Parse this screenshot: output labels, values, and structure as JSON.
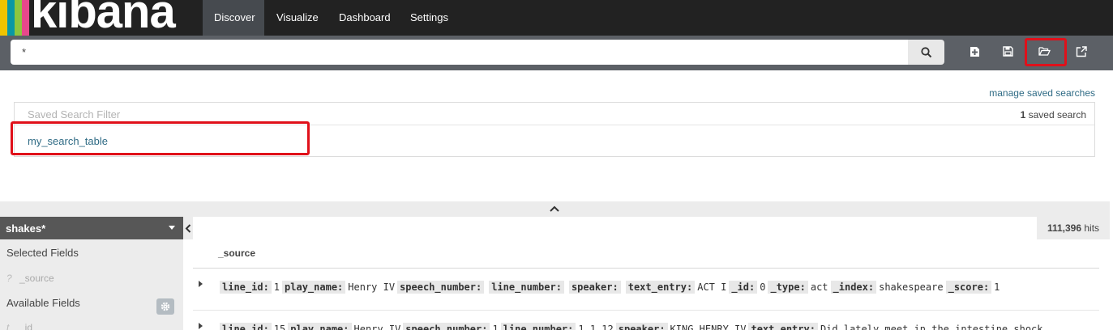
{
  "app": {
    "logo_text": "kibana",
    "logo_colors": [
      "#f1c400",
      "#0a98a4",
      "#8dc63f",
      "#e8488b"
    ]
  },
  "nav": {
    "tabs": [
      {
        "label": "Discover",
        "active": true
      },
      {
        "label": "Visualize",
        "active": false
      },
      {
        "label": "Dashboard",
        "active": false
      },
      {
        "label": "Settings",
        "active": false
      }
    ]
  },
  "search": {
    "query": "*",
    "icon": "search-icon"
  },
  "toolbar": {
    "icons": [
      "new-search-icon",
      "save-icon",
      "open-folder-icon",
      "share-icon"
    ],
    "highlighted": "open-folder-icon",
    "highlight_color": "#e0101a"
  },
  "saved_searches": {
    "manage_link": "manage saved searches",
    "filter_placeholder": "Saved Search Filter",
    "count": "1",
    "count_label": "saved search",
    "items": [
      "my_search_table"
    ]
  },
  "sidebar": {
    "index_pattern": "shakes*",
    "selected_heading": "Selected Fields",
    "selected_fields": [
      {
        "type": "?",
        "name": "_source"
      }
    ],
    "available_heading": "Available Fields",
    "available_fields": [
      {
        "type": "t",
        "name": "_id"
      }
    ]
  },
  "results": {
    "hits": "111,396",
    "hits_label": "hits",
    "column": "_source",
    "rows": [
      {
        "fields": [
          {
            "key": "line_id:",
            "value": "1"
          },
          {
            "key": "play_name:",
            "value": "Henry IV"
          },
          {
            "key": "speech_number:",
            "value": ""
          },
          {
            "key": "line_number:",
            "value": ""
          },
          {
            "key": "speaker:",
            "value": ""
          },
          {
            "key": "text_entry:",
            "value": "ACT I"
          },
          {
            "key": "_id:",
            "value": "0"
          },
          {
            "key": "_type:",
            "value": "act"
          },
          {
            "key": "_index:",
            "value": "shakespeare"
          },
          {
            "key": "_score:",
            "value": "1"
          }
        ]
      },
      {
        "fields": [
          {
            "key": "line_id:",
            "value": "15"
          },
          {
            "key": "play_name:",
            "value": "Henry IV"
          },
          {
            "key": "speech_number:",
            "value": "1"
          },
          {
            "key": "line_number:",
            "value": "1.1.12"
          },
          {
            "key": "speaker:",
            "value": "KING HENRY IV"
          },
          {
            "key": "text_entry:",
            "value": "Did lately meet in the intestine shock"
          }
        ]
      }
    ]
  }
}
